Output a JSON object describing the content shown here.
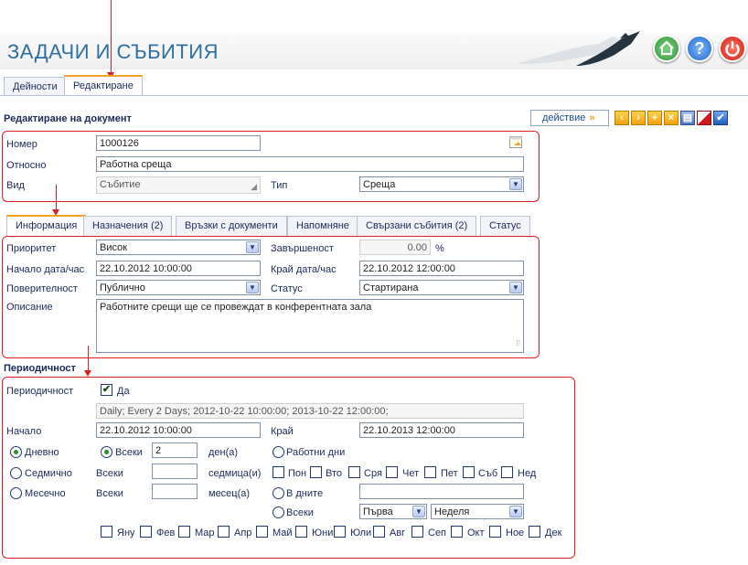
{
  "app": {
    "title": "ЗАДАЧИ И СЪБИТИЯ",
    "home_icon": "home-icon",
    "help_label": "?",
    "power_icon": "power-icon"
  },
  "top_tabs": [
    {
      "label": "Дейности"
    },
    {
      "label": "Редактиране"
    }
  ],
  "doc": {
    "title": "Редактиране на документ",
    "action_label": "действие",
    "action_chevron": "»"
  },
  "toolbar": {
    "buttons": [
      "chevron-left-icon",
      "chevron-right-icon",
      "add-icon",
      "delete-icon",
      "print-icon",
      "cancel-icon",
      "confirm-icon"
    ]
  },
  "header_fields": {
    "number_label": "Номер",
    "number_value": "1000126",
    "subject_label": "Относно",
    "subject_value": "Работна среща",
    "kind_label": "Вид",
    "kind_value": "Събитие",
    "type_label": "Тип",
    "type_value": "Среща"
  },
  "inner_tabs": [
    {
      "label": "Информация"
    },
    {
      "label": "Назначения (2)"
    },
    {
      "label": "Връзки с документи"
    },
    {
      "label": "Напомняне"
    },
    {
      "label": "Свързани събития (2)"
    },
    {
      "label": "Статус"
    }
  ],
  "info": {
    "priority_label": "Приоритет",
    "priority_value": "Висок",
    "completion_label": "Завършеност",
    "completion_value": "0.00",
    "completion_unit": "%",
    "start_label": "Начало дата/час",
    "start_value": "22.10.2012 10:00:00",
    "end_label": "Край дата/час",
    "end_value": "22.10.2012 12:00:00",
    "privacy_label": "Поверителност",
    "privacy_value": "Публично",
    "status_label": "Статус",
    "status_value": "Стартирана",
    "description_label": "Описание",
    "description_value": "Работните срещи ще се провеждат в конферентната зала"
  },
  "periodicity": {
    "section_title": "Периодичност",
    "label": "Периодичност",
    "yes_label": "Да",
    "summary": "Daily; Every 2 Days; 2012-10-22 10:00:00; 2013-10-22 12:00:00;",
    "start_label": "Начало",
    "start_value": "22.10.2012 10:00:00",
    "end_label": "Край",
    "end_value": "22.10.2013 12:00:00",
    "daily_label": "Дневно",
    "weekly_label": "Седмично",
    "monthly_label": "Месечно",
    "every_label": "Всеки",
    "every_days_value": "2",
    "days_unit": "ден(а)",
    "every_weeks_label": "Всеки",
    "weeks_unit": "седмица(и)",
    "every_months_label": "Всеки",
    "months_unit": "месец(а)",
    "workdays_label": "Работни дни",
    "weekdays": [
      "Пон",
      "Вто",
      "Сря",
      "Чет",
      "Пет",
      "Съб",
      "Нед"
    ],
    "in_days_label": "В дните",
    "every_label2": "Всеки",
    "first_value": "Първа",
    "weekday_value": "Неделя",
    "months": [
      "Яну",
      "Фев",
      "Мар",
      "Апр",
      "Май",
      "Юни",
      "Юли",
      "Авг",
      "Сеп",
      "Окт",
      "Ное",
      "Дек"
    ]
  },
  "colors": {
    "accent": "#2f6f9f",
    "annotation": "#e02020",
    "tab_highlight": "#f0a020"
  }
}
